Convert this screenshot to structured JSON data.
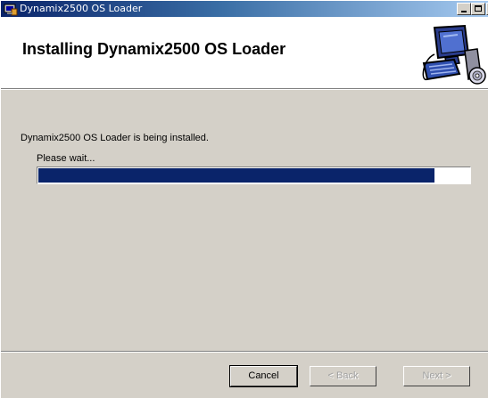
{
  "window": {
    "title": "Dynamix2500 OS Loader"
  },
  "banner": {
    "heading": "Installing Dynamix2500 OS Loader",
    "graphic_icon": "computer-icon"
  },
  "main": {
    "status": "Dynamix2500 OS Loader is being installed.",
    "wait_label": "Please wait...",
    "progress_fraction": 0.92
  },
  "buttons": {
    "cancel": "Cancel",
    "back": "< Back",
    "next": "Next >"
  },
  "colors": {
    "titlebar_start": "#0a246a",
    "titlebar_end": "#a6caf0",
    "progress_fill": "#0a246a",
    "dialog_bg": "#d4d0c8"
  }
}
